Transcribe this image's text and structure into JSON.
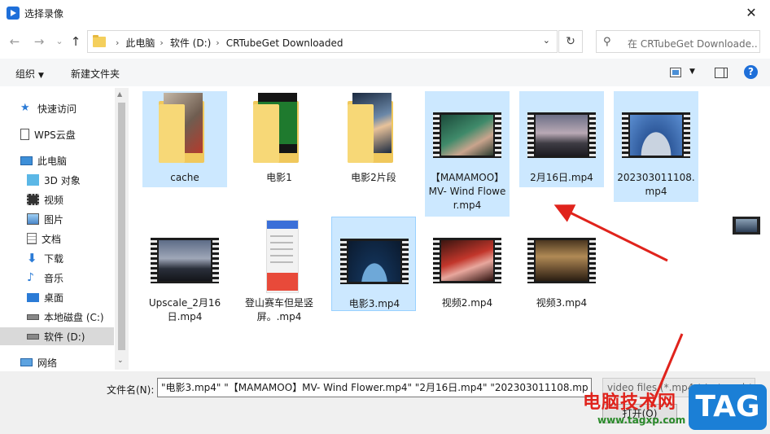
{
  "window": {
    "title": "选择录像",
    "close_glyph": "✕"
  },
  "nav": {
    "back_glyph": "←",
    "forward_glyph": "→",
    "recent_glyph": "⌄",
    "up_glyph": "↑",
    "breadcrumbs": [
      "此电脑",
      "软件 (D:)",
      "CRTubeGet Downloaded"
    ],
    "separator": "›",
    "refresh_glyph": "↻",
    "search_placeholder": "在 CRTubeGet Downloade..."
  },
  "toolbar": {
    "organize": "组织",
    "new_folder": "新建文件夹",
    "help": "?"
  },
  "sidebar": {
    "items": [
      {
        "label": "快速访问",
        "icon": "star-icon"
      },
      {
        "label": "WPS云盘",
        "icon": "cloud-doc-icon"
      },
      {
        "label": "此电脑",
        "icon": "computer-icon"
      },
      {
        "label": "3D 对象",
        "icon": "cube-icon"
      },
      {
        "label": "视频",
        "icon": "video-icon"
      },
      {
        "label": "图片",
        "icon": "picture-icon"
      },
      {
        "label": "文档",
        "icon": "document-icon"
      },
      {
        "label": "下载",
        "icon": "download-icon"
      },
      {
        "label": "音乐",
        "icon": "music-icon"
      },
      {
        "label": "桌面",
        "icon": "desktop-icon"
      },
      {
        "label": "本地磁盘 (C:)",
        "icon": "drive-icon"
      },
      {
        "label": "软件 (D:)",
        "icon": "drive-icon"
      },
      {
        "label": "网络",
        "icon": "network-icon"
      }
    ]
  },
  "files": [
    {
      "name": "cache",
      "kind": "folder"
    },
    {
      "name": "电影1",
      "kind": "folder"
    },
    {
      "name": "电影2片段",
      "kind": "folder"
    },
    {
      "name": "【MAMAMOO】MV- Wind Flower.mp4",
      "kind": "video"
    },
    {
      "name": "2月16日.mp4",
      "kind": "video"
    },
    {
      "name": "202303011108.mp4",
      "kind": "video"
    },
    {
      "name": "Upscale_2月16日.mp4",
      "kind": "video"
    },
    {
      "name": "登山赛车但是竖屏。.mp4",
      "kind": "video"
    },
    {
      "name": "电影3.mp4",
      "kind": "video"
    },
    {
      "name": "视频2.mp4",
      "kind": "video"
    },
    {
      "name": "视频3.mp4",
      "kind": "video"
    }
  ],
  "footer": {
    "filename_label": "文件名(N):",
    "filename_value": "\"电影3.mp4\" \"【MAMAMOO】MV- Wind Flower.mp4\" \"2月16日.mp4\" \"202303011108.mp",
    "filetype_value": "video files (*.mp4 *.ts *.wvd *.",
    "open_label": "打开(O)"
  },
  "watermark": {
    "text": "电脑技术网",
    "url": "www.tagxp.com",
    "tag": "TAG"
  },
  "colors": {
    "selection": "#cce8ff",
    "accent": "#1e6fd9",
    "annotation_arrow": "#e0231c"
  }
}
